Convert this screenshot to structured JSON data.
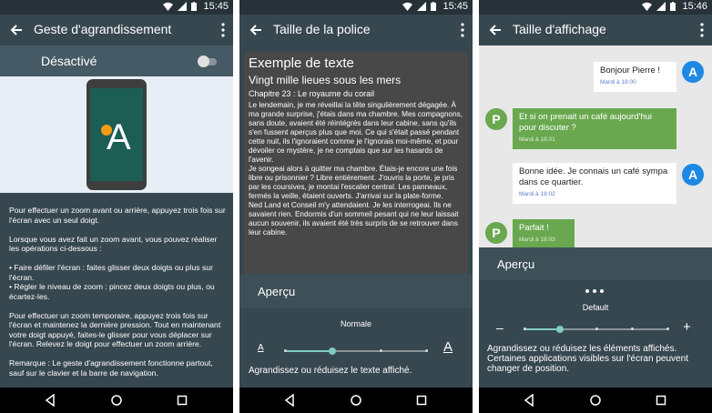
{
  "status": {
    "time1": "15:45",
    "time2": "15:45",
    "time3": "15:46"
  },
  "panel1": {
    "title": "Geste d'agrandissement",
    "toggle_label": "Désactivé",
    "illustration_letter": "A",
    "paragraphs": [
      "Pour effectuer un zoom avant ou arrière, appuyez trois fois sur l'écran avec un seul doigt.",
      "Lorsque vous avez fait un zoom avant, vous pouvez réaliser les opérations ci-dessous :",
      "• Faire défiler l'écran : faites glisser deux doigts ou plus sur l'écran.\n• Régler le niveau de zoom : pincez deux doigts ou plus, ou écartez-les.",
      "Pour effectuer un zoom temporaire, appuyez trois fois sur l'écran et maintenez la dernière pression. Tout en maintenant votre doigt appuyé, faites-le glisser pour vous déplacer sur l'écran. Relevez le doigt pour effectuer un zoom arrière.",
      "Remarque : Le geste d'agrandissement fonctionne partout, sauf sur le clavier et la barre de navigation."
    ]
  },
  "panel2": {
    "title": "Taille de la police",
    "sample_heading": "Exemple de texte",
    "sample_subtitle": "Vingt mille lieues sous les mers",
    "sample_chapter": "Chapitre 23 : Le royaume du corail",
    "sample_body": "Le lendemain, je me réveillai la tête singulièrement dégagée. À ma grande surprise, j'étais dans ma chambre. Mes compagnons, sans doute, avaient été réintégrés dans leur cabine, sans qu'ils s'en fussent aperçus plus que moi. Ce qui s'était passé pendant cette nuit, ils l'ignoraient comme je l'ignorais moi-même, et pour dévoiler ce mystère, je ne comptais que sur les hasards de l'avenir.\nJe songeai alors à quitter ma chambre. Étais-je encore une fois libre ou prisonnier ? Libre entièrement. J'ouvris la porte, je pris par les coursives, je montai l'escalier central. Les panneaux, fermés la veille, étaient ouverts. J'arrivai sur la plate-forme.\nNed Land et Conseil m'y attendaient. Je les interrogeai. Ils ne savaient rien. Endormis d'un sommeil pesant qui ne leur laissait aucun souvenir, ils avaient été très surpris de se retrouver dans leur cabine.",
    "preview_label": "Aperçu",
    "level_label": "Normale",
    "slider_value_fraction": 0.333,
    "small_a": "A",
    "big_a": "A",
    "hint": "Agrandissez ou réduisez le texte affiché."
  },
  "panel3": {
    "title": "Taille d'affichage",
    "messages": [
      {
        "text": "Bonjour Pierre !",
        "time": "Mardi à 18:00",
        "avatar": "A"
      },
      {
        "text": "Et si on prenait un café aujourd'hui pour discuter ?",
        "time": "Mardi à 18:01",
        "avatar": "P"
      },
      {
        "text": "Bonne idée. Je connais un café sympa dans ce quartier.",
        "time": "Mardi à 18:02",
        "avatar": "A"
      },
      {
        "text": "Parfait !",
        "time": "Mardi à 18:03",
        "avatar": "P"
      }
    ],
    "preview_label": "Aperçu",
    "level_label": "Default",
    "slider_value_fraction": 0.25,
    "minus": "–",
    "plus": "+",
    "hint": "Agrandissez ou réduisez les éléments affichés. Certaines applications visibles sur l'écran peuvent changer de position."
  },
  "colors": {
    "accent": "#80cbc4",
    "green_bubble": "#6aa84f",
    "blue_avatar": "#1e88e5",
    "appbar": "#37474f"
  }
}
